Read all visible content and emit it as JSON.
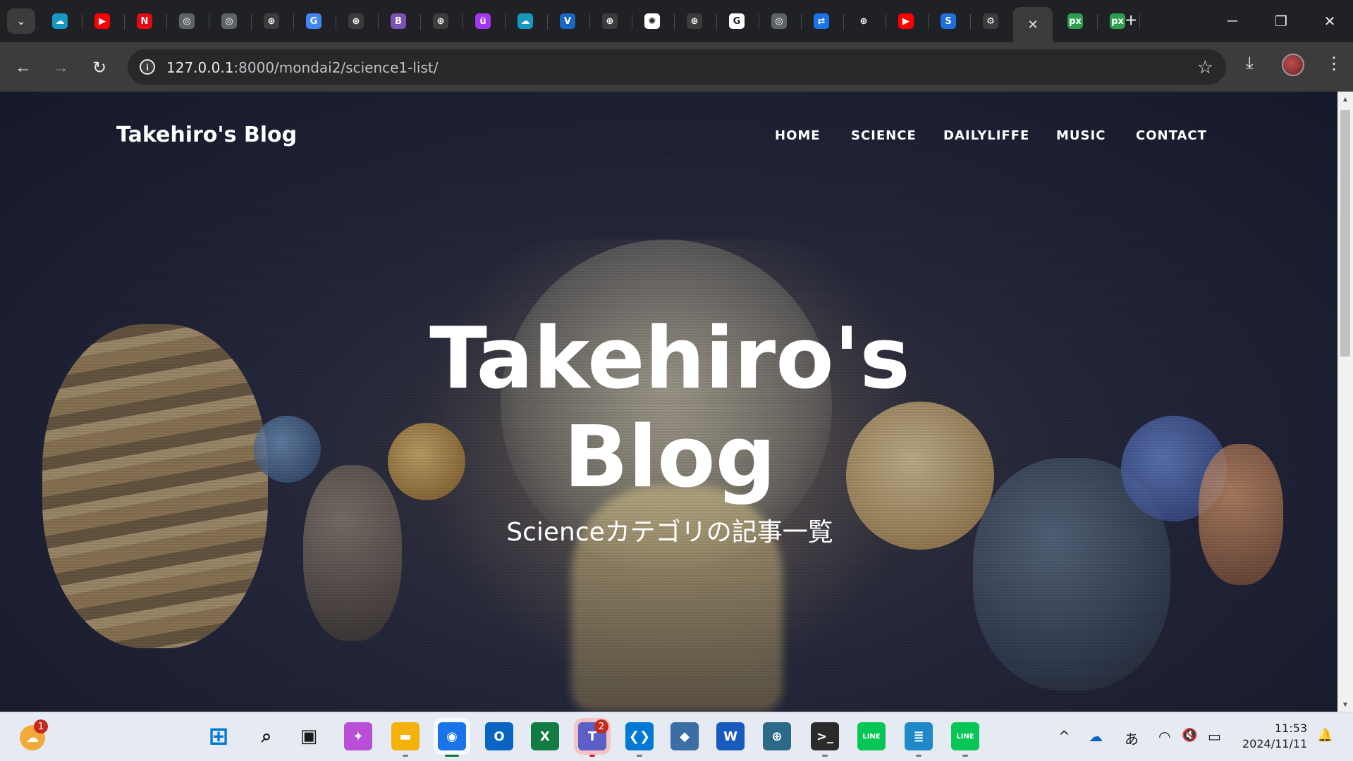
{
  "browser": {
    "tabs": [
      {
        "icon": "salesforce-icon",
        "glyph": "☁",
        "color": "#1798c1"
      },
      {
        "icon": "youtube-icon",
        "glyph": "▶",
        "color": "#ff0000"
      },
      {
        "icon": "netflix-icon",
        "glyph": "N",
        "color": "#e50914"
      },
      {
        "icon": "chrome-icon",
        "glyph": "◎",
        "color": "#5f6368"
      },
      {
        "icon": "chrome-icon",
        "glyph": "◎",
        "color": "#5f6368"
      },
      {
        "icon": "globe-icon",
        "glyph": "⊕",
        "color": "#3c3c3c"
      },
      {
        "icon": "google-lens-icon",
        "glyph": "G",
        "color": "#4285f4"
      },
      {
        "icon": "globe-icon",
        "glyph": "⊕",
        "color": "#3c3c3c"
      },
      {
        "icon": "bootstrap-icon",
        "glyph": "B",
        "color": "#7952b3"
      },
      {
        "icon": "globe-icon",
        "glyph": "⊕",
        "color": "#3c3c3c"
      },
      {
        "icon": "udemy-icon",
        "glyph": "ü",
        "color": "#a435f0"
      },
      {
        "icon": "salesforce-icon",
        "glyph": "☁",
        "color": "#1798c1"
      },
      {
        "icon": "vuetify-icon",
        "glyph": "V",
        "color": "#1867c0"
      },
      {
        "icon": "globe-icon",
        "glyph": "⊕",
        "color": "#3c3c3c"
      },
      {
        "icon": "chatgpt-icon",
        "glyph": "✺",
        "color": "#ffffff"
      },
      {
        "icon": "globe-icon",
        "glyph": "⊕",
        "color": "#3c3c3c"
      },
      {
        "icon": "google-icon",
        "glyph": "G",
        "color": "#ffffff"
      },
      {
        "icon": "chrome-icon",
        "glyph": "◎",
        "color": "#5f6368"
      },
      {
        "icon": "translate-icon",
        "glyph": "⇄",
        "color": "#1a73e8"
      },
      {
        "icon": "globe-icon",
        "glyph": "⊕",
        "color": "#202124"
      },
      {
        "icon": "youtube-icon",
        "glyph": "▶",
        "color": "#ff0000"
      },
      {
        "icon": "app-s-icon",
        "glyph": "S",
        "color": "#1e6fd9"
      },
      {
        "icon": "settings-icon",
        "glyph": "⚙",
        "color": "#3c3c3c"
      },
      {
        "icon": "close-icon",
        "glyph": "✕",
        "color": "#3c3c3c",
        "active": true
      },
      {
        "icon": "pixlr-icon",
        "glyph": "px",
        "color": "#2e9e4e"
      },
      {
        "icon": "pixlr-icon",
        "glyph": "px",
        "color": "#2e9e4e"
      }
    ],
    "new_tab_glyph": "+",
    "window_controls": {
      "minimize": "─",
      "restore": "❐",
      "close": "✕"
    },
    "nav": {
      "back": "←",
      "forward": "→",
      "reload": "↻"
    },
    "address": {
      "host": "127.0.0.1",
      "rest": ":8000/mondai2/science1-list/"
    },
    "bookmark_glyph": "☆",
    "download_glyph": "⤓",
    "menu_glyph": "⋮"
  },
  "site": {
    "brand": "Takehiro's Blog",
    "nav": [
      "HOME",
      "SCIENCE",
      "DAILYLIFFE",
      "MUSIC",
      "CONTACT"
    ],
    "hero_title_line1": "Takehiro's",
    "hero_title_line2": "Blog",
    "hero_subtitle": "Scienceカテゴリの記事一覧"
  },
  "taskbar": {
    "weather_badge": "1",
    "teams_badge": "2",
    "apps": [
      {
        "icon": "windows-start-icon",
        "glyph": "⊞",
        "color": "#0078d4"
      },
      {
        "icon": "search-icon",
        "glyph": "⌕",
        "color": "#1a1a1a"
      },
      {
        "icon": "task-view-icon",
        "glyph": "▣",
        "color": "#1a1a1a"
      },
      {
        "icon": "copilot-icon",
        "glyph": "✦",
        "color": "#b84fd6"
      },
      {
        "icon": "file-explorer-icon",
        "glyph": "▬",
        "color": "#f2b20a"
      },
      {
        "icon": "chrome-icon",
        "glyph": "◉",
        "color": "#1a73e8"
      },
      {
        "icon": "outlook-icon",
        "glyph": "O",
        "color": "#0a64c4"
      },
      {
        "icon": "excel-icon",
        "glyph": "X",
        "color": "#107c41"
      },
      {
        "icon": "teams-icon",
        "glyph": "T",
        "color": "#5b5fc7"
      },
      {
        "icon": "vscode-icon",
        "glyph": "❮❯",
        "color": "#0078d4"
      },
      {
        "icon": "virtualbox-icon",
        "glyph": "◆",
        "color": "#3b6ea5"
      },
      {
        "icon": "word-icon",
        "glyph": "W",
        "color": "#185abd"
      },
      {
        "icon": "remote-desktop-icon",
        "glyph": "⊕",
        "color": "#2d6a8a"
      },
      {
        "icon": "terminal-icon",
        "glyph": ">_",
        "color": "#2b2b2b"
      },
      {
        "icon": "line-icon",
        "glyph": "LINE",
        "color": "#06c755"
      },
      {
        "icon": "notepad-icon",
        "glyph": "≣",
        "color": "#1e88c8"
      },
      {
        "icon": "line-icon",
        "glyph": "LINE",
        "color": "#06c755"
      }
    ],
    "tray": {
      "chevron": "^",
      "onedrive": "☁",
      "ime": "あ",
      "wifi": "◠",
      "volume": "🔇",
      "battery": "▭"
    },
    "time": "11:53",
    "date": "2024/11/11",
    "notification_glyph": "🔔"
  }
}
